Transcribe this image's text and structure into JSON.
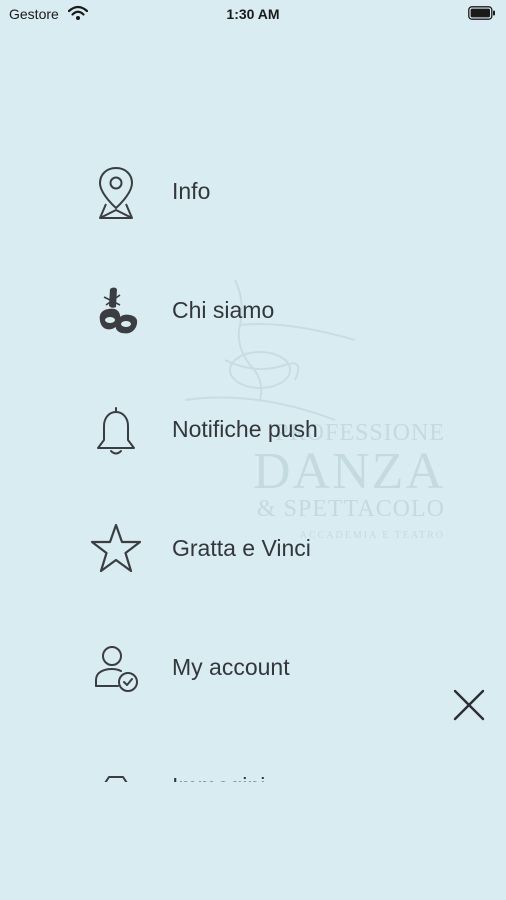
{
  "status_bar": {
    "carrier": "Gestore",
    "time": "1:30 AM"
  },
  "watermark": {
    "line1": "PROFESSIONE",
    "line2": "DANZA",
    "line3": "& SPETTACOLO",
    "line4": "ACCADEMIA E TEATRO"
  },
  "menu": {
    "items": [
      {
        "label": "Info",
        "icon": "map-pin-icon"
      },
      {
        "label": "Chi siamo",
        "icon": "ballet-shoes-icon"
      },
      {
        "label": "Notifiche push",
        "icon": "bell-icon"
      },
      {
        "label": "Gratta e Vinci",
        "icon": "star-icon"
      },
      {
        "label": "My account",
        "icon": "user-check-icon"
      },
      {
        "label": "Immagini",
        "icon": "camera-icon"
      }
    ]
  },
  "close": {
    "icon": "close-icon"
  },
  "colors": {
    "background": "#d9ecf1",
    "text": "#33373b",
    "icon_stroke": "#3a3e42"
  }
}
